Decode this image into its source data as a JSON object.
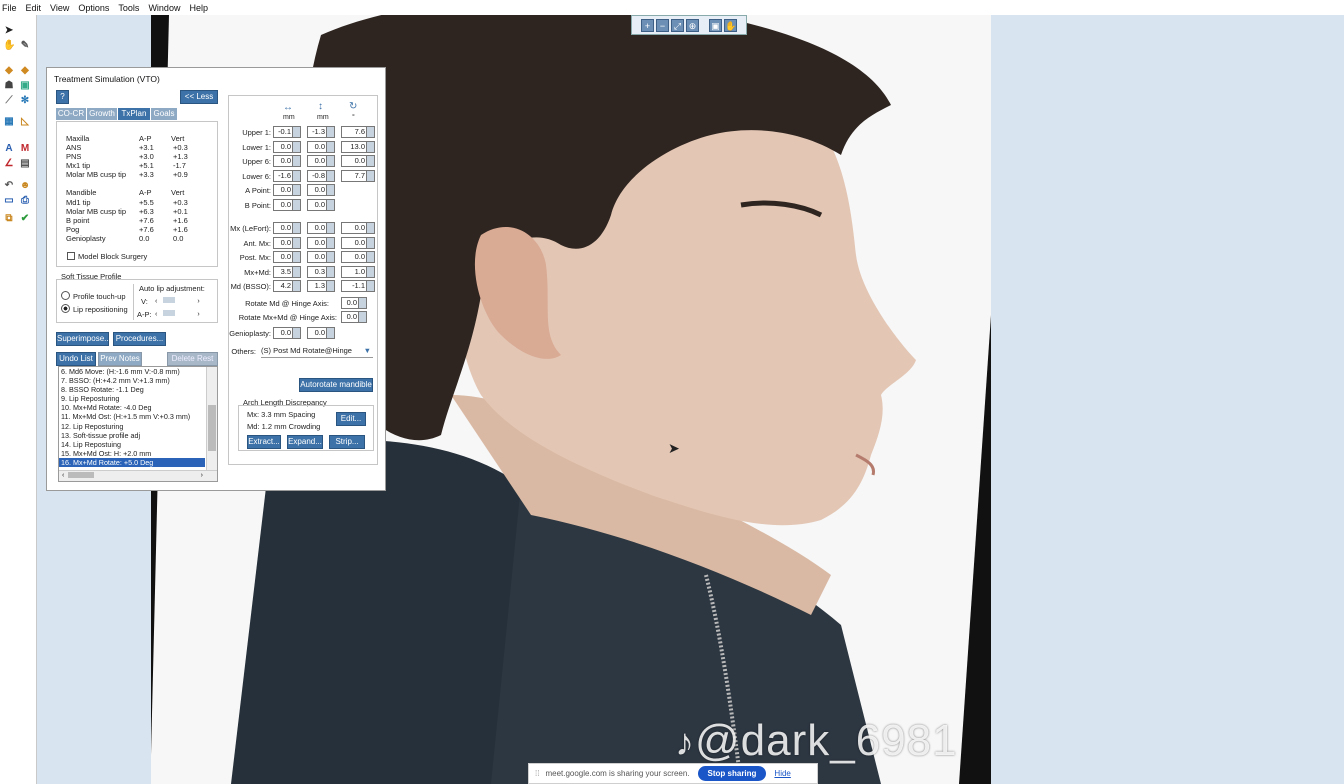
{
  "menu": [
    "File",
    "Edit",
    "View",
    "Options",
    "Tools",
    "Window",
    "Help"
  ],
  "dialog": {
    "title": "Treatment Simulation (VTO)",
    "help_btn": "?",
    "less_btn": "<< Less",
    "tabs": [
      "CO-CR",
      "Growth",
      "TxPlan",
      "Goals"
    ],
    "active_tab": 2,
    "maxilla": {
      "header": [
        "Maxilla",
        "A-P",
        "Vert"
      ],
      "rows": [
        [
          "ANS",
          "+3.1",
          "+0.3"
        ],
        [
          "PNS",
          "+3.0",
          "+1.3"
        ],
        [
          "Mx1 tip",
          "+5.1",
          "-1.7"
        ],
        [
          "Molar MB cusp tip",
          "+3.3",
          "+0.9"
        ]
      ]
    },
    "mandible": {
      "header": [
        "Mandible",
        "A-P",
        "Vert"
      ],
      "rows": [
        [
          "Md1 tip",
          "+5.5",
          "+0.3"
        ],
        [
          "Molar MB cusp tip",
          "+6.3",
          "+0.1"
        ],
        [
          "B point",
          "+7.6",
          "+1.6"
        ],
        [
          "Pog",
          "+7.6",
          "+1.6"
        ],
        [
          "Genioplasty",
          "0.0",
          "0.0"
        ]
      ]
    },
    "model_block": "Model Block Surgery",
    "soft_tissue": {
      "title": "Soft Tissue Profile",
      "opt1": "Profile touch-up",
      "opt2": "Lip repositioning",
      "auto_lip": "Auto lip adjustment:",
      "v": "V:",
      "ap": "A-P:"
    },
    "superimpose": "Superimpose...",
    "procedures": "Procedures...",
    "undo_list": "Undo List",
    "prev_notes": "Prev Notes",
    "delete_rest": "Delete Rest",
    "undo_items": [
      "6.  Md6 Move: (H:-1.6 mm V:-0.8 mm)",
      "7.  BSSO: (H:+4.2 mm V:+1.3 mm)",
      "8.  BSSO Rotate: -1.1 Deg",
      "9.  Lip Reposturing",
      "10.  Mx+Md Rotate: -4.0 Deg",
      "11.  Mx+Md Ost: (H:+1.5 mm V:+0.3 mm)",
      "12.  Lip Reposturing",
      "13.  Soft-tissue profile adj",
      "14.  Lip Repostuing",
      "15.  Mx+Md Ost: H: +2.0 mm",
      "16.  Mx+Md Rotate: +5.0 Deg"
    ],
    "units": [
      "mm",
      "mm",
      "°"
    ],
    "teeth": [
      {
        "label": "Upper 1:",
        "h": "-0.1",
        "v": "-1.3",
        "r": "7.6"
      },
      {
        "label": "Lower 1:",
        "h": "0.0",
        "v": "0.0",
        "r": "13.0"
      },
      {
        "label": "Upper 6:",
        "h": "0.0",
        "v": "0.0",
        "r": "0.0"
      },
      {
        "label": "Lower 6:",
        "h": "-1.6",
        "v": "-0.8",
        "r": "7.7"
      },
      {
        "label": "A Point:",
        "h": "0.0",
        "v": "0.0"
      },
      {
        "label": "B Point:",
        "h": "0.0",
        "v": "0.0"
      }
    ],
    "jaws": [
      {
        "label": "Mx (LeFort):",
        "h": "0.0",
        "v": "0.0",
        "r": "0.0"
      },
      {
        "label": "Ant. Mx:",
        "h": "0.0",
        "v": "0.0",
        "r": "0.0"
      },
      {
        "label": "Post. Mx:",
        "h": "0.0",
        "v": "0.0",
        "r": "0.0"
      },
      {
        "label": "Mx+Md:",
        "h": "3.5",
        "v": "0.3",
        "r": "1.0"
      },
      {
        "label": "Md (BSSO):",
        "h": "4.2",
        "v": "1.3",
        "r": "-1.1"
      }
    ],
    "rotate_md": {
      "label": "Rotate Md @ Hinge Axis:",
      "value": "0.0"
    },
    "rotate_mxmd": {
      "label": "Rotate Mx+Md @ Hinge Axis:",
      "value": "0.0"
    },
    "genioplasty": {
      "label": "Genioplasty:",
      "h": "0.0",
      "v": "0.0"
    },
    "others": {
      "label": "Others:",
      "value": "(S) Post Md Rotate@Hinge"
    },
    "autorotate": "Autorotate mandible",
    "arch": {
      "title": "Arch Length Discrepancy",
      "mx": "Mx:  3.3 mm Spacing",
      "md": "Md:  1.2 mm Crowding",
      "edit": "Edit...",
      "extract": "Extract...",
      "expand": "Expand...",
      "strip": "Strip..."
    }
  },
  "watermark": "@dark_6981",
  "share": {
    "text": "meet.google.com is sharing your screen.",
    "stop": "Stop sharing",
    "hide": "Hide"
  },
  "colors": {
    "accent": "#3d72a8",
    "selection": "#2a63b8",
    "panel_bg": "#d8e5f1"
  }
}
